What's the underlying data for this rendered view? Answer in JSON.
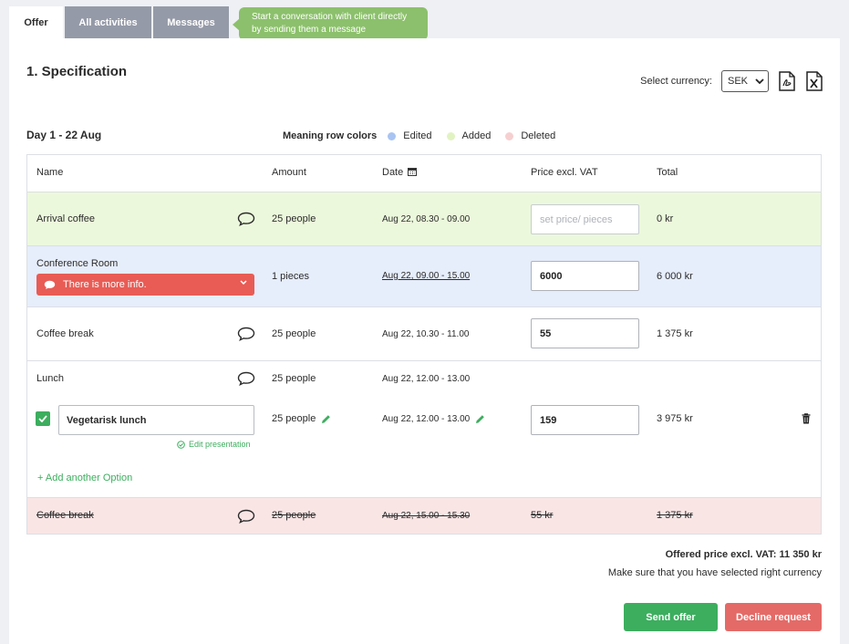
{
  "tabs": [
    {
      "label": "Offer",
      "active": true
    },
    {
      "label": "All activities",
      "active": false
    },
    {
      "label": "Messages",
      "active": false
    }
  ],
  "tooltip": {
    "line1": "Start a conversation with client directly",
    "line2": "by sending them a message"
  },
  "spec": {
    "title": "1. Specification",
    "currency_label": "Select currency:",
    "currency_value": "SEK",
    "day": "Day 1 - 22 Aug"
  },
  "legend": {
    "title": "Meaning row colors",
    "items": [
      {
        "label": "Edited",
        "color": "#a9c4f2"
      },
      {
        "label": "Added",
        "color": "#e2f3c2"
      },
      {
        "label": "Deleted",
        "color": "#f6d0d0"
      }
    ]
  },
  "table": {
    "headers": {
      "name": "Name",
      "amount": "Amount",
      "date": "Date",
      "price": "Price excl. VAT",
      "total": "Total"
    },
    "rows": [
      {
        "name": "Arrival coffee",
        "amount": "25 people",
        "date": "Aug 22, 08.30 - 09.00",
        "price_placeholder": "set price/ pieces",
        "total": "0 kr"
      },
      {
        "name": "Conference Room",
        "alert": "There is more info.",
        "amount": "1 pieces",
        "date": "Aug 22, 09.00 - 15.00",
        "price": "6000",
        "total": "6 000 kr"
      },
      {
        "name": "Coffee break",
        "amount": "25 people",
        "date": "Aug 22, 10.30 - 11.00",
        "price": "55",
        "total": "1 375 kr"
      },
      {
        "name": "Lunch",
        "amount": "25 people",
        "date": "Aug 22, 12.00 - 13.00",
        "option": {
          "name": "Vegetarisk lunch",
          "edit_label": "Edit presentation",
          "amount": "25 people",
          "date": "Aug 22, 12.00 - 13.00",
          "price": "159",
          "total": "3 975 kr"
        },
        "add_option": "+ Add another Option"
      },
      {
        "name": "Coffee break",
        "amount": "25 people",
        "date": "Aug 22, 15.00 - 15.30",
        "price": "55 kr",
        "total": "1 375 kr"
      }
    ]
  },
  "summary": {
    "offered": "Offered price excl. VAT: 11 350 kr",
    "note": "Make sure that you have selected right currency"
  },
  "buttons": {
    "send": "Send offer",
    "decline": "Decline request"
  },
  "colors": {
    "added_row": "#ecf8dc",
    "edited_row": "#e6edfb",
    "deleted_row": "#fae5e5",
    "green": "#3cae5e",
    "red": "#e85c55"
  }
}
